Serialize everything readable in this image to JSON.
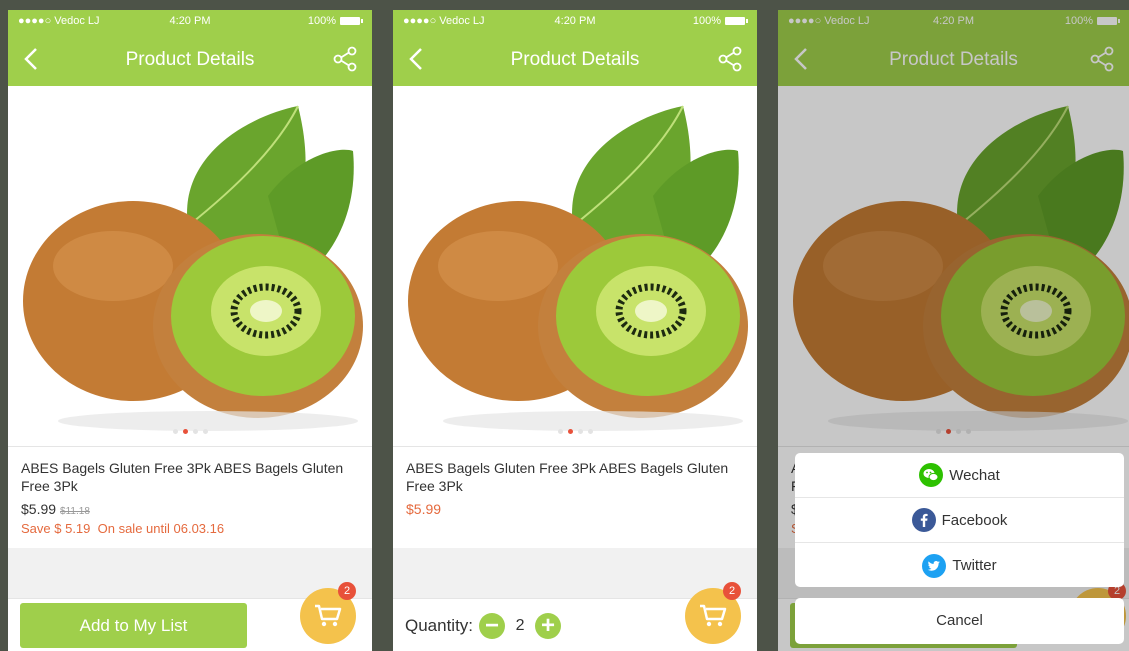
{
  "status_bar": {
    "carrier": "●●●●○ Vedoc LJ",
    "time": "4:20 PM",
    "battery": "100%"
  },
  "nav": {
    "title": "Product Details",
    "back_icon": "chevron-left-icon",
    "share_icon": "share-icon"
  },
  "product": {
    "name": "ABES Bagels Gluten Free 3Pk ABES Bagels Gluten Free 3Pk",
    "price": "$5.99",
    "old_price": "$11.18",
    "save_text": "Save $ 5.19",
    "sale_until": "On sale until 06.03.16",
    "image_pages": 4,
    "image_active_page": 2
  },
  "screen1": {
    "add_button": "Add to My List",
    "cart_count": "2"
  },
  "screen2": {
    "quantity_label": "Quantity:",
    "quantity_value": "2",
    "cart_count": "2"
  },
  "screen3": {
    "share_options": [
      {
        "label": "Wechat",
        "icon": "wechat-icon",
        "color": "#2dc100"
      },
      {
        "label": "Facebook",
        "icon": "facebook-icon",
        "color": "#3b5998"
      },
      {
        "label": "Twitter",
        "icon": "twitter-icon",
        "color": "#1da1f2"
      }
    ],
    "cancel": "Cancel",
    "cart_count": "2"
  },
  "colors": {
    "accent": "#9fcf4b",
    "sale": "#e56a3e",
    "cart": "#f4c24c",
    "badge": "#e8513a"
  }
}
